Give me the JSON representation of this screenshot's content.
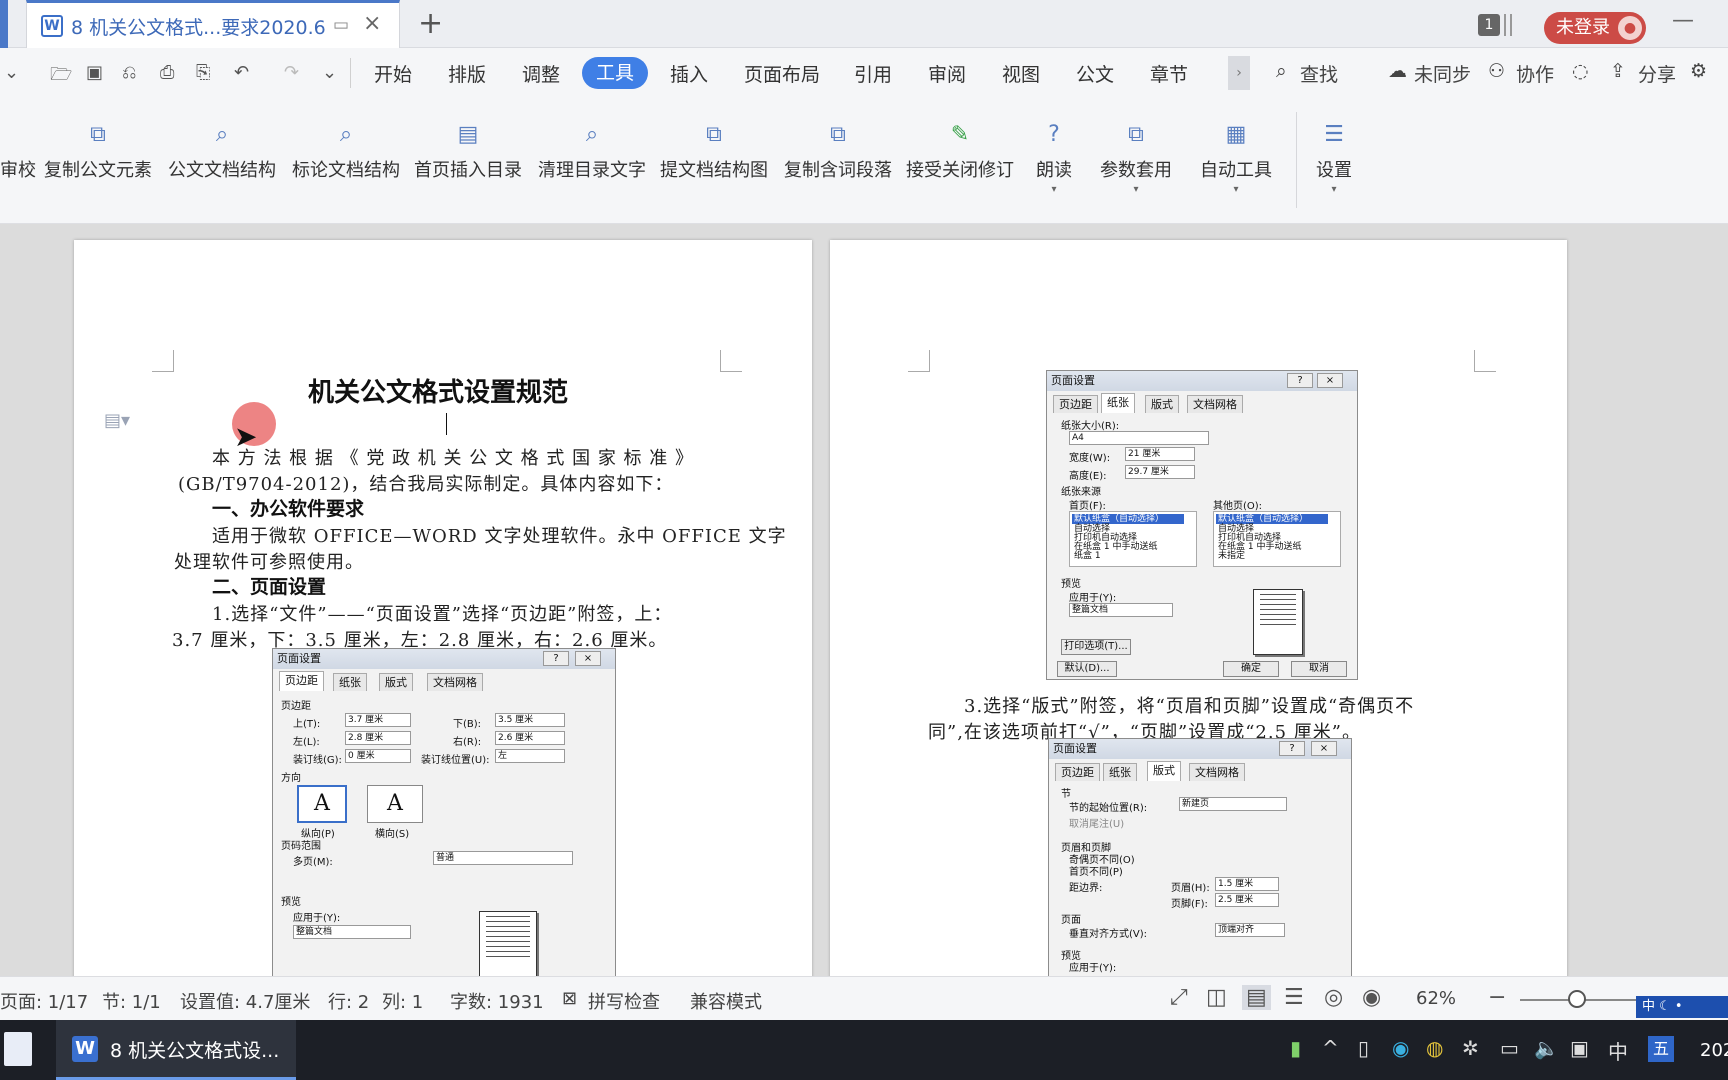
{
  "titlebar": {
    "tab_title": "8 机关公文格式...要求2020.6",
    "new_tab": "+",
    "close": "×",
    "badge_count": "1",
    "login_label": "未登录",
    "minimize": "—"
  },
  "menu": {
    "items": [
      "开始",
      "排版",
      "调整",
      "工具",
      "插入",
      "页面布局",
      "引用",
      "审阅",
      "视图",
      "公文",
      "章节"
    ],
    "active": "工具",
    "more": "›",
    "search": "查找",
    "sync": "未同步",
    "collab": "协作",
    "share": "分享"
  },
  "ribbon": {
    "buttons": [
      "审校",
      "复制公文元素",
      "公文文档结构",
      "标论文档结构",
      "首页插入目录",
      "清理目录文字",
      "提文档结构图",
      "复制含词段落",
      "接受关闭修订",
      "朗读",
      "参数套用",
      "自动工具",
      "设置"
    ]
  },
  "page1": {
    "title": "机关公文格式设置规范",
    "para1_line1": "本 方 法 根 据 《 党 政 机 关 公 文 格 式 国 家 标 准 》",
    "para1_line2": "(GB/T9704-2012)，结合我局实际制定。具体内容如下：",
    "head1": "一、办公软件要求",
    "para2_line1": "适用于微软 OFFICE—WORD 文字处理软件。永中 OFFICE 文字",
    "para2_line2": "处理软件可参照使用。",
    "head2": "二、页面设置",
    "para3_line1": "1.选择“文件”——“页面设置”选择“页边距”附签，上：",
    "para3_line2": "3.7 厘米，下：3.5 厘米，左：2.8 厘米，右：2.6 厘米。",
    "dialog": {
      "title": "页面设置",
      "tabs": [
        "页边距",
        "纸张",
        "版式",
        "文档网格"
      ],
      "group_margins": "页边距",
      "top_label": "上(T):",
      "top_value": "3.7 厘米",
      "bottom_label": "下(B):",
      "bottom_value": "3.5 厘米",
      "left_label": "左(L):",
      "left_value": "2.8 厘米",
      "right_label": "右(R):",
      "right_value": "2.6 厘米",
      "gutter_label": "装订线(G):",
      "gutter_value": "0 厘米",
      "gutter_pos_label": "装订线位置(U):",
      "gutter_pos_value": "左",
      "orientation": "方向",
      "portrait": "纵向(P)",
      "landscape": "横向(S)",
      "pages_group": "页码范围",
      "multi_label": "多页(M):",
      "multi_value": "普通",
      "preview": "预览",
      "apply_label": "应用于(Y):",
      "apply_value": "整篇文档"
    }
  },
  "page2": {
    "dialog_paper": {
      "title": "页面设置",
      "tabs": [
        "页边距",
        "纸张",
        "版式",
        "文档网格"
      ],
      "size_label": "纸张大小(R):",
      "size_value": "A4",
      "width_label": "宽度(W):",
      "width_value": "21 厘米",
      "height_label": "高度(E):",
      "height_value": "29.7 厘米",
      "source": "纸张来源",
      "first_page": "首页(F):",
      "other_pages": "其他页(O):",
      "list_selected": "默认纸盒（自动选择）",
      "list_items": [
        "自动选择",
        "打印机自动选择",
        "在纸盒 1 中手动送纸",
        "纸盒 1",
        "未指定"
      ],
      "preview": "预览",
      "apply_label": "应用于(Y):",
      "apply_value": "整篇文档",
      "print_options": "打印选项(T)...",
      "default_btn": "默认(D)...",
      "ok": "确定",
      "cancel": "取消"
    },
    "para_line1": "3.选择“版式”附签，将“页眉和页脚”设置成“奇偶页不",
    "para_line2": "同”,在该选项前打“√”，“页脚”设置成“2.5 厘米”。",
    "dialog_layout": {
      "title": "页面设置",
      "tabs": [
        "页边距",
        "纸张",
        "版式",
        "文档网格"
      ],
      "section": "节",
      "section_start": "节的起始位置(R):",
      "section_value": "新建页",
      "cancel_endnote": "取消尾注(U)",
      "hf": "页眉和页脚",
      "odd_even": "奇偶页不同(O)",
      "first_diff": "首页不同(P)",
      "distance": "距边界:",
      "header_label": "页眉(H):",
      "header_value": "1.5 厘米",
      "footer_label": "页脚(F):",
      "footer_value": "2.5 厘米",
      "page": "页面",
      "valign_label": "垂直对齐方式(V):",
      "valign_value": "顶端对齐",
      "preview": "预览",
      "apply_label": "应用于(Y):"
    }
  },
  "statusbar": {
    "page": "页面: 1/17",
    "section": "节: 1/1",
    "setting": "设置值: 4.7厘米",
    "row": "行: 2",
    "col": "列: 1",
    "words": "字数: 1931",
    "spell": "拼写检查",
    "compat": "兼容模式",
    "zoom": "62%",
    "ime": "中"
  },
  "taskbar": {
    "app_title": "8 机关公文格式设...",
    "ime": "中",
    "wubi": "五",
    "clock": "202"
  }
}
